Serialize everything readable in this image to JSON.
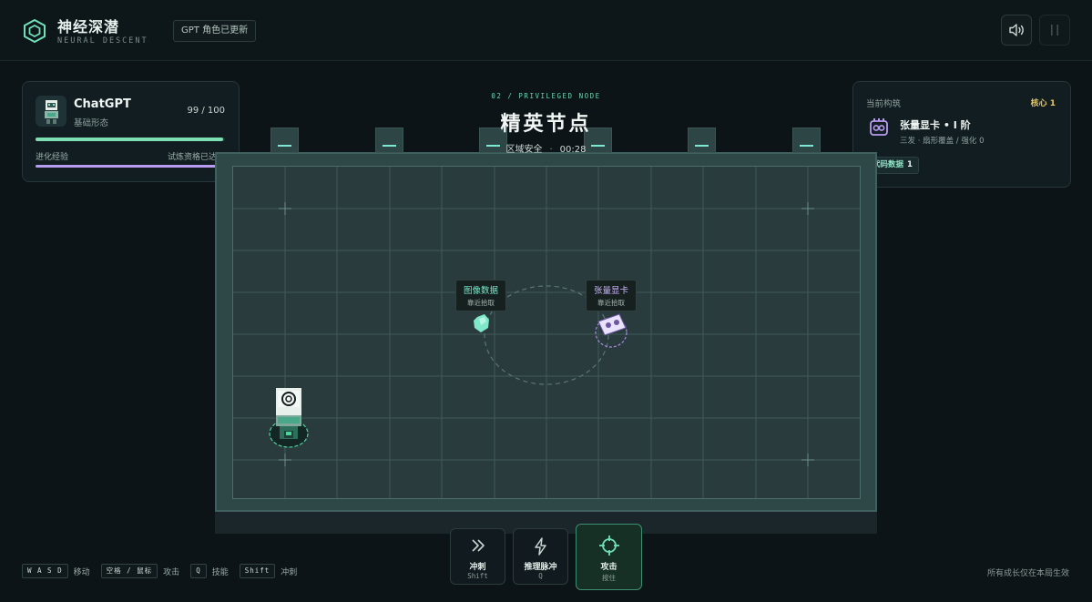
{
  "header": {
    "title": "神经深潜",
    "subtitle": "NEURAL DESCENT",
    "badge": "GPT 角色已更新",
    "icons": [
      "hexagon-logo-icon",
      "speaker-icon",
      "pause-icon"
    ]
  },
  "player": {
    "name": "ChatGPT",
    "form": "基础形态",
    "hp_current": 99,
    "hp_max": 100,
    "hp_text": "99 / 100",
    "xp_label": "进化经验",
    "xp_note": "试炼资格已达成",
    "xp_fraction": 1.0,
    "hp_color": "#7ee0b2",
    "xp_color": "#b89cf0"
  },
  "build": {
    "title": "当前构筑",
    "core_label": "核心 1",
    "item_name": "张量显卡 • I 阶",
    "item_desc": "三发 · 扇形覆盖 / 强化 0",
    "chip_label": "代码数据",
    "chip_count": "1",
    "accent": "#e6c866"
  },
  "node": {
    "tag": "02 / PRIVILEGED NODE",
    "title": "精英节点",
    "status": "区域安全",
    "timer": "00:28"
  },
  "pickups": [
    {
      "title": "图像数据",
      "sub": "靠近拾取",
      "color": "#7ee8c8"
    },
    {
      "title": "张量显卡",
      "sub": "靠近拾取",
      "color": "#c9b4f7"
    }
  ],
  "abilities": [
    {
      "name": "冲刺",
      "key": "Shift",
      "icon": "double-chevron-icon"
    },
    {
      "name": "推理脉冲",
      "key": "Q",
      "icon": "lightning-icon"
    },
    {
      "name": "攻击",
      "key": "按住",
      "icon": "crosshair-icon"
    }
  ],
  "controls": [
    {
      "keys": "W A S D",
      "label": "移动"
    },
    {
      "keys": "空格 / 鼠标",
      "label": "攻击"
    },
    {
      "keys": "Q",
      "label": "技能"
    },
    {
      "keys": "Shift",
      "label": "冲刺"
    }
  ],
  "footer_note": "所有成长仅在本局生效"
}
